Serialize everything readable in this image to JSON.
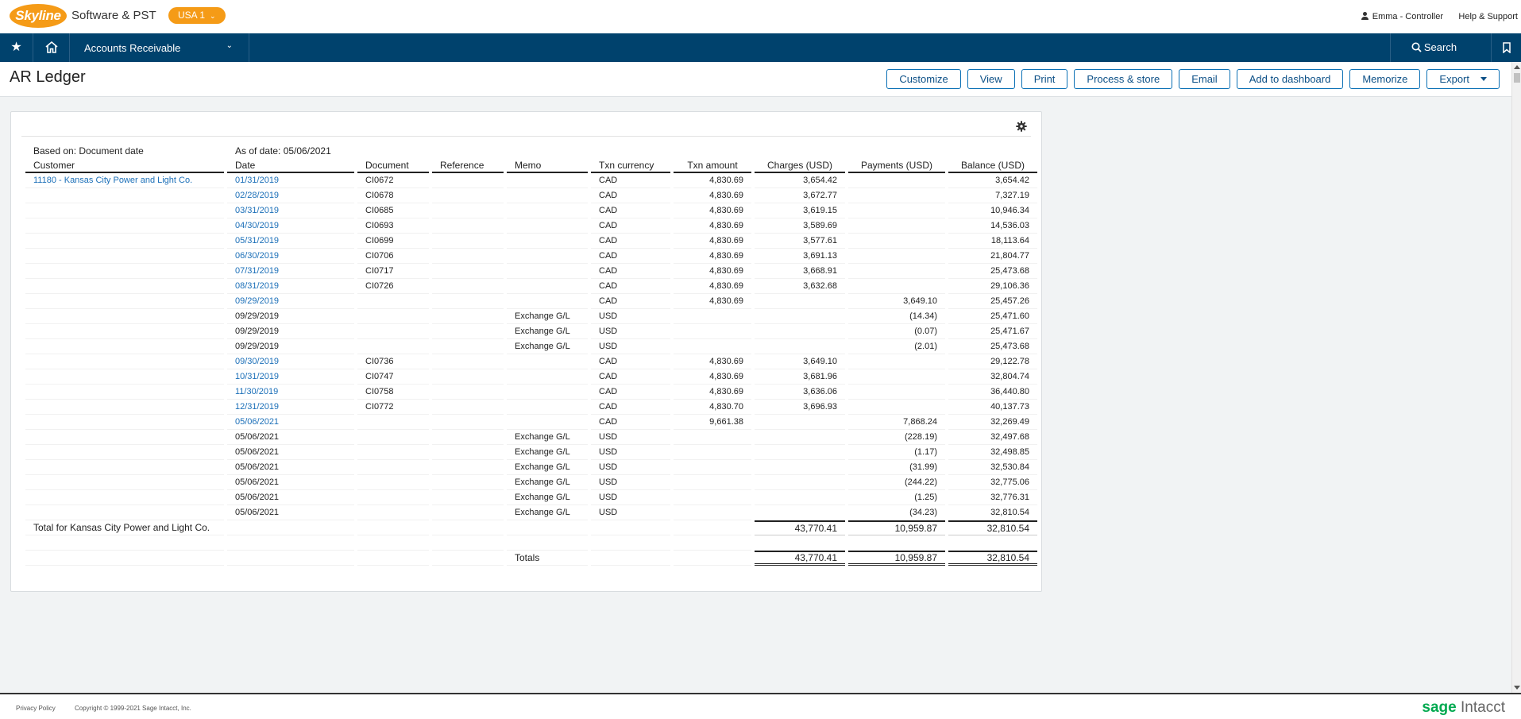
{
  "topbar": {
    "logo_text": "Skyline",
    "company": "Software & PST",
    "entity": "USA 1",
    "user": "Emma - Controller",
    "help": "Help & Support"
  },
  "nav": {
    "module": "Accounts Receivable",
    "search": "Search"
  },
  "page": {
    "title": "AR Ledger",
    "actions": [
      "Customize",
      "View",
      "Print",
      "Process & store",
      "Email",
      "Add to dashboard",
      "Memorize",
      "Export"
    ]
  },
  "report": {
    "based_on": "Based on: Document date",
    "as_of": "As of date: 05/06/2021",
    "columns": [
      "Customer",
      "Date",
      "Document",
      "Reference",
      "Memo",
      "Txn currency",
      "Txn amount",
      "Charges (USD)",
      "Payments (USD)",
      "Balance (USD)"
    ],
    "customer": "11180 - Kansas City Power and Light Co.",
    "rows": [
      {
        "date": "01/31/2019",
        "date_link": true,
        "doc": "CI0672",
        "ref": "",
        "memo": "",
        "cur": "CAD",
        "amt": "4,830.69",
        "chg": "3,654.42",
        "pay": "",
        "bal": "3,654.42"
      },
      {
        "date": "02/28/2019",
        "date_link": true,
        "doc": "CI0678",
        "ref": "",
        "memo": "",
        "cur": "CAD",
        "amt": "4,830.69",
        "chg": "3,672.77",
        "pay": "",
        "bal": "7,327.19"
      },
      {
        "date": "03/31/2019",
        "date_link": true,
        "doc": "CI0685",
        "ref": "",
        "memo": "",
        "cur": "CAD",
        "amt": "4,830.69",
        "chg": "3,619.15",
        "pay": "",
        "bal": "10,946.34"
      },
      {
        "date": "04/30/2019",
        "date_link": true,
        "doc": "CI0693",
        "ref": "",
        "memo": "",
        "cur": "CAD",
        "amt": "4,830.69",
        "chg": "3,589.69",
        "pay": "",
        "bal": "14,536.03"
      },
      {
        "date": "05/31/2019",
        "date_link": true,
        "doc": "CI0699",
        "ref": "",
        "memo": "",
        "cur": "CAD",
        "amt": "4,830.69",
        "chg": "3,577.61",
        "pay": "",
        "bal": "18,113.64"
      },
      {
        "date": "06/30/2019",
        "date_link": true,
        "doc": "CI0706",
        "ref": "",
        "memo": "",
        "cur": "CAD",
        "amt": "4,830.69",
        "chg": "3,691.13",
        "pay": "",
        "bal": "21,804.77"
      },
      {
        "date": "07/31/2019",
        "date_link": true,
        "doc": "CI0717",
        "ref": "",
        "memo": "",
        "cur": "CAD",
        "amt": "4,830.69",
        "chg": "3,668.91",
        "pay": "",
        "bal": "25,473.68"
      },
      {
        "date": "08/31/2019",
        "date_link": true,
        "doc": "CI0726",
        "ref": "",
        "memo": "",
        "cur": "CAD",
        "amt": "4,830.69",
        "chg": "3,632.68",
        "pay": "",
        "bal": "29,106.36"
      },
      {
        "date": "09/29/2019",
        "date_link": true,
        "doc": "",
        "ref": "",
        "memo": "",
        "cur": "CAD",
        "amt": "4,830.69",
        "chg": "",
        "pay": "3,649.10",
        "bal": "25,457.26"
      },
      {
        "date": "09/29/2019",
        "date_link": false,
        "doc": "",
        "ref": "",
        "memo": "Exchange G/L",
        "cur": "USD",
        "amt": "",
        "chg": "",
        "pay": "(14.34)",
        "bal": "25,471.60"
      },
      {
        "date": "09/29/2019",
        "date_link": false,
        "doc": "",
        "ref": "",
        "memo": "Exchange G/L",
        "cur": "USD",
        "amt": "",
        "chg": "",
        "pay": "(0.07)",
        "bal": "25,471.67"
      },
      {
        "date": "09/29/2019",
        "date_link": false,
        "doc": "",
        "ref": "",
        "memo": "Exchange G/L",
        "cur": "USD",
        "amt": "",
        "chg": "",
        "pay": "(2.01)",
        "bal": "25,473.68"
      },
      {
        "date": "09/30/2019",
        "date_link": true,
        "doc": "CI0736",
        "ref": "",
        "memo": "",
        "cur": "CAD",
        "amt": "4,830.69",
        "chg": "3,649.10",
        "pay": "",
        "bal": "29,122.78"
      },
      {
        "date": "10/31/2019",
        "date_link": true,
        "doc": "CI0747",
        "ref": "",
        "memo": "",
        "cur": "CAD",
        "amt": "4,830.69",
        "chg": "3,681.96",
        "pay": "",
        "bal": "32,804.74"
      },
      {
        "date": "11/30/2019",
        "date_link": true,
        "doc": "CI0758",
        "ref": "",
        "memo": "",
        "cur": "CAD",
        "amt": "4,830.69",
        "chg": "3,636.06",
        "pay": "",
        "bal": "36,440.80"
      },
      {
        "date": "12/31/2019",
        "date_link": true,
        "doc": "CI0772",
        "ref": "",
        "memo": "",
        "cur": "CAD",
        "amt": "4,830.70",
        "chg": "3,696.93",
        "pay": "",
        "bal": "40,137.73"
      },
      {
        "date": "05/06/2021",
        "date_link": true,
        "doc": "",
        "ref": "",
        "memo": "",
        "cur": "CAD",
        "amt": "9,661.38",
        "chg": "",
        "pay": "7,868.24",
        "bal": "32,269.49"
      },
      {
        "date": "05/06/2021",
        "date_link": false,
        "doc": "",
        "ref": "",
        "memo": "Exchange G/L",
        "cur": "USD",
        "amt": "",
        "chg": "",
        "pay": "(228.19)",
        "bal": "32,497.68"
      },
      {
        "date": "05/06/2021",
        "date_link": false,
        "doc": "",
        "ref": "",
        "memo": "Exchange G/L",
        "cur": "USD",
        "amt": "",
        "chg": "",
        "pay": "(1.17)",
        "bal": "32,498.85"
      },
      {
        "date": "05/06/2021",
        "date_link": false,
        "doc": "",
        "ref": "",
        "memo": "Exchange G/L",
        "cur": "USD",
        "amt": "",
        "chg": "",
        "pay": "(31.99)",
        "bal": "32,530.84"
      },
      {
        "date": "05/06/2021",
        "date_link": false,
        "doc": "",
        "ref": "",
        "memo": "Exchange G/L",
        "cur": "USD",
        "amt": "",
        "chg": "",
        "pay": "(244.22)",
        "bal": "32,775.06"
      },
      {
        "date": "05/06/2021",
        "date_link": false,
        "doc": "",
        "ref": "",
        "memo": "Exchange G/L",
        "cur": "USD",
        "amt": "",
        "chg": "",
        "pay": "(1.25)",
        "bal": "32,776.31"
      },
      {
        "date": "05/06/2021",
        "date_link": false,
        "doc": "",
        "ref": "",
        "memo": "Exchange G/L",
        "cur": "USD",
        "amt": "",
        "chg": "",
        "pay": "(34.23)",
        "bal": "32,810.54"
      }
    ],
    "customer_total": {
      "label": "Total for Kansas City Power and Light Co.",
      "chg": "43,770.41",
      "pay": "10,959.87",
      "bal": "32,810.54"
    },
    "grand_total": {
      "label": "Totals",
      "chg": "43,770.41",
      "pay": "10,959.87",
      "bal": "32,810.54"
    }
  },
  "footer": {
    "privacy": "Privacy Policy",
    "copyright": "Copyright © 1999-2021 Sage Intacct, Inc.",
    "brand_sage": "sage",
    "brand_intacct": "Intacct"
  },
  "colors": {
    "nav": "#00426d",
    "accent": "#f59b17",
    "link": "#1b6fb8",
    "button_border": "#0b70b5",
    "sage_green": "#00a94f"
  },
  "icons": [
    "star-icon",
    "home-icon",
    "chevron-down-icon",
    "user-icon",
    "search-icon",
    "bookmark-icon",
    "gear-icon"
  ]
}
